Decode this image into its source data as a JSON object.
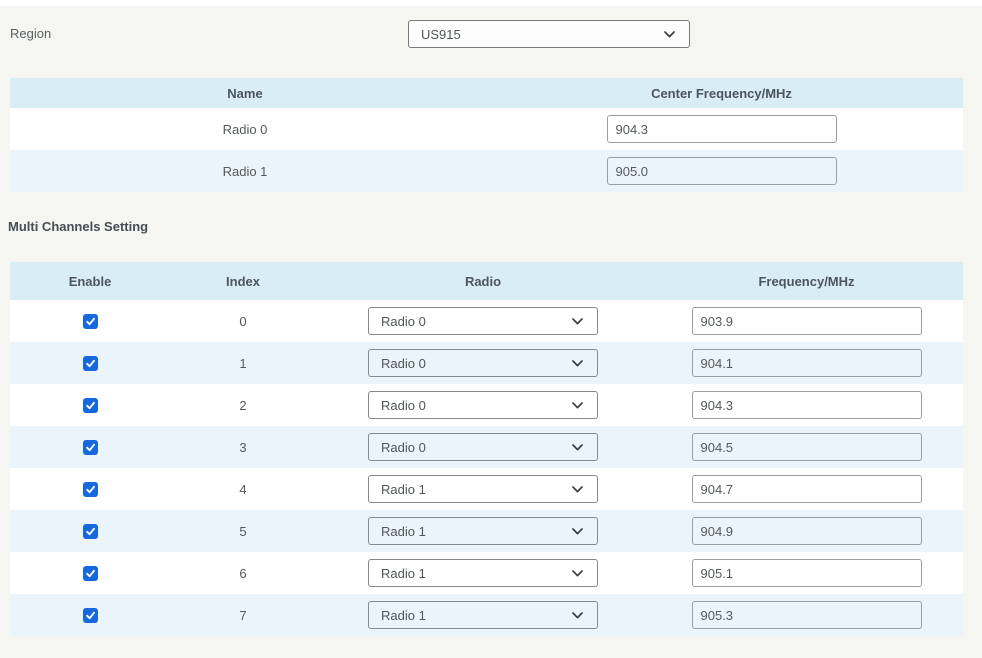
{
  "region": {
    "label": "Region",
    "value": "US915"
  },
  "radios_table": {
    "headers": {
      "name": "Name",
      "center_frequency": "Center Frequency/MHz"
    },
    "rows": [
      {
        "name": "Radio 0",
        "center_frequency": "904.3"
      },
      {
        "name": "Radio 1",
        "center_frequency": "905.0"
      }
    ]
  },
  "multi_channels": {
    "title": "Multi Channels Setting",
    "headers": {
      "enable": "Enable",
      "index": "Index",
      "radio": "Radio",
      "frequency": "Frequency/MHz"
    },
    "rows": [
      {
        "enabled": true,
        "index": "0",
        "radio": "Radio 0",
        "frequency": "903.9"
      },
      {
        "enabled": true,
        "index": "1",
        "radio": "Radio 0",
        "frequency": "904.1"
      },
      {
        "enabled": true,
        "index": "2",
        "radio": "Radio 0",
        "frequency": "904.3"
      },
      {
        "enabled": true,
        "index": "3",
        "radio": "Radio 0",
        "frequency": "904.5"
      },
      {
        "enabled": true,
        "index": "4",
        "radio": "Radio 1",
        "frequency": "904.7"
      },
      {
        "enabled": true,
        "index": "5",
        "radio": "Radio 1",
        "frequency": "904.9"
      },
      {
        "enabled": true,
        "index": "6",
        "radio": "Radio 1",
        "frequency": "905.1"
      },
      {
        "enabled": true,
        "index": "7",
        "radio": "Radio 1",
        "frequency": "905.3"
      }
    ]
  },
  "colors": {
    "table_header_bg": "#d9edf6",
    "row_alt_bg": "#ebf4fa",
    "checkbox_blue": "#1767dd",
    "page_bg": "#f5f6f2"
  },
  "icons": {
    "select_arrow": "chevron-down",
    "checkbox_mark": "check"
  }
}
